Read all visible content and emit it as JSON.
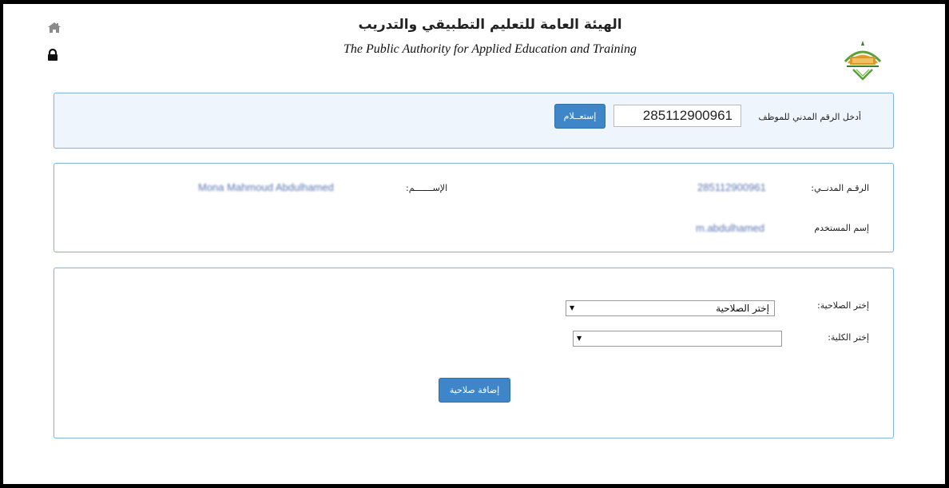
{
  "header": {
    "title_ar": "الهيئة العامة للتعليم التطبيقي والتدريب",
    "title_en": "The Public Authority for Applied Education and Training"
  },
  "search": {
    "label": "أدخل الرقم المدني للموظف",
    "civil_id_value": "285112900961",
    "query_button": "إستعــلام"
  },
  "info": {
    "civil_id_label": "الرقـم المدنــي:",
    "civil_id_value": "285112900961",
    "name_label": "الإســـــــم:",
    "name_value": "Mona Mahmoud Abdulhamed",
    "username_label": "إسم المستخدم",
    "username_value": "m.abdulhamed"
  },
  "permission": {
    "role_label": "إختر الصلاحية:",
    "role_selected": "إختر الصلاحية",
    "college_label": "إختر الكلية:",
    "college_selected": "",
    "add_button": "إضافة صلاحية"
  },
  "icons": {
    "home": "home-icon",
    "lock": "lock-icon",
    "logo": "paaet-logo"
  },
  "colors": {
    "accent": "#3f86c9",
    "panel_border": "#8ab4d8",
    "search_panel_bg": "#eef5fc"
  }
}
